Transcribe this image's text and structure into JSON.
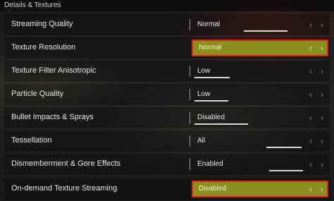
{
  "section_title": "Details & Textures",
  "arrows": {
    "left": "‹",
    "right": "›"
  },
  "settings": [
    {
      "label": "Streaming Quality",
      "value": "Normal",
      "highlighted": false
    },
    {
      "label": "Texture Resolution",
      "value": "Normal",
      "highlighted": true
    },
    {
      "label": "Texture Filter Anisotropic",
      "value": "Low",
      "highlighted": false
    },
    {
      "label": "Particle Quality",
      "value": "Low",
      "highlighted": false
    },
    {
      "label": "Bullet Impacts & Sprays",
      "value": "Disabled",
      "highlighted": false
    },
    {
      "label": "Tessellation",
      "value": "All",
      "highlighted": false
    },
    {
      "label": "Dismemberment & Gore Effects",
      "value": "Enabled",
      "highlighted": false
    },
    {
      "label": "On-demand Texture Streaming",
      "value": "Disabled",
      "highlighted": true
    }
  ],
  "colors": {
    "highlight_fill": "#8a8f1e",
    "highlight_border": "#e12020"
  }
}
